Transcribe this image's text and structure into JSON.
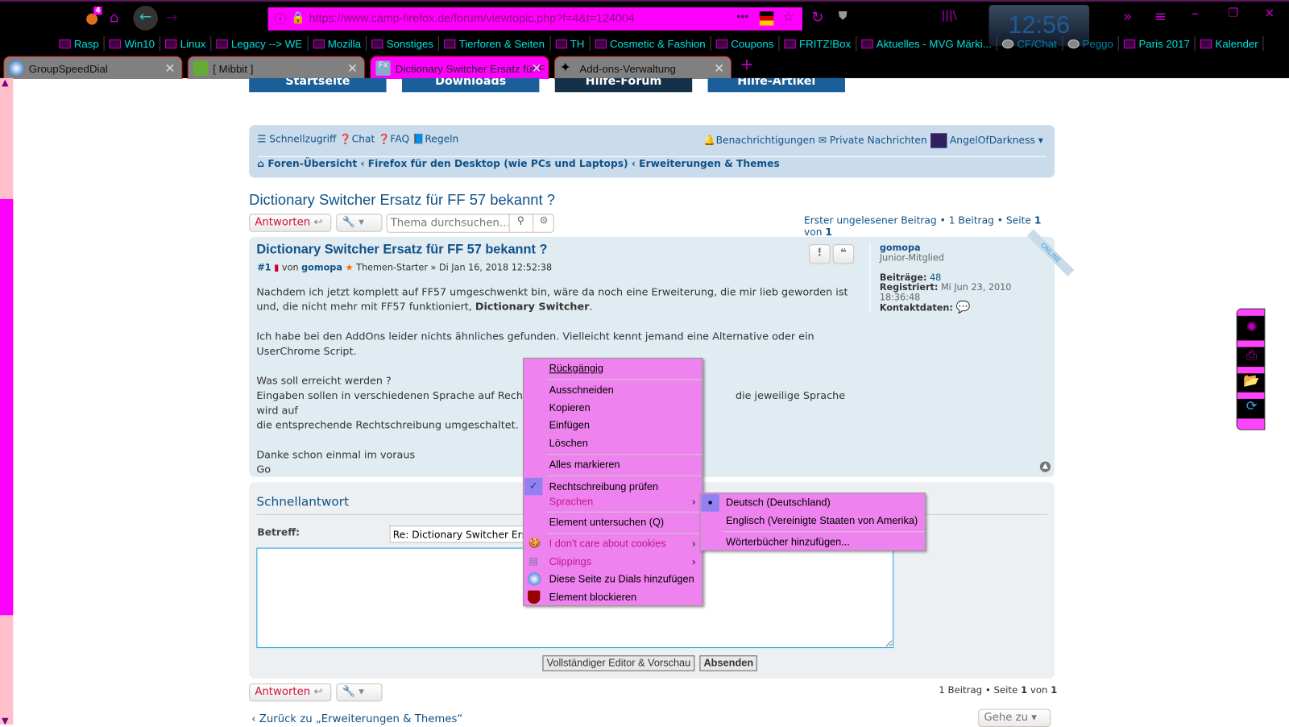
{
  "browser": {
    "badge": "4",
    "url": "https://www.camp-firefox.de/forum/viewtopic.php?f=4&t=124004",
    "clock": "12:56",
    "bookmarks": [
      "Rasp",
      "Win10",
      "Linux",
      "Legacy --> WE",
      "Mozilla",
      "Sonstiges",
      "Tierforen & Seiten",
      "TH",
      "Cosmetic & Fashion",
      "Coupons",
      "FRITZ!Box",
      "Aktuelles - MVG Märki...",
      "CF/Chat",
      "Peggo",
      "Paris 2017",
      "Kalender"
    ],
    "tabs": [
      {
        "label": "GroupSpeedDial"
      },
      {
        "label": "[ Mibbit ]"
      },
      {
        "label": "Dictionary Switcher Ersatz für F"
      },
      {
        "label": "Add-ons-Verwaltung"
      }
    ],
    "colors": {
      "accent": "#ff00ff",
      "chrome_bg": "#000000",
      "bookmark_text": "#00e0e0",
      "menu_bg": "#ee82ee"
    }
  },
  "site_nav": [
    "Startseite",
    "Downloads",
    "Hilfe-Forum",
    "Hilfe-Artikel"
  ],
  "navbar": {
    "quick": "Schnellzugriff",
    "chat": "Chat",
    "faq": "FAQ",
    "rules": "Regeln",
    "notifications": "Benachrichtigungen",
    "pm": "Private Nachrichten",
    "user": "AngelOfDarkness",
    "crumbs": [
      "Foren-Übersicht",
      "Firefox für den Desktop (wie PCs und Laptops)",
      "Erweiterungen & Themes"
    ]
  },
  "topic": {
    "title": "Dictionary Switcher Ersatz für FF 57 bekannt ?",
    "reply": "Antworten",
    "search_placeholder": "Thema durchsuchen...",
    "first_unread": "Erster ungelesener Beitrag",
    "count": "1 Beitrag",
    "page_label": "Seite",
    "page": "1",
    "of": "von",
    "pages": "1"
  },
  "post": {
    "title": "Dictionary Switcher Ersatz für FF 57 bekannt ?",
    "num": "#1",
    "by": "von",
    "author": "gomopa",
    "starter": "Themen-Starter",
    "date": "» Di Jan 16, 2018 12:52:38",
    "p1a": "Nachdem ich jetzt komplett auf FF57 umgeschwenkt bin, wäre da noch eine Erweiterung, die mir lieb geworden ist und, die nicht mehr mit FF57 funktioniert, ",
    "p1b": "Dictionary Switcher",
    "p1c": ".",
    "p2": "Ich habe bei den AddOns leider nichts ähnliches gefunden. Vielleicht kennt jemand eine Alternative oder ein UserChrome Script.",
    "p3": "Was soll erreicht werden ?",
    "p4a": "Eingaben sollen in verschiedenen Sprache auf Rechtschre",
    "p4b": "die jeweilige Sprache wird auf",
    "p4c": "die entsprechende Rechtschreibung umgeschaltet.",
    "p5": "Danke schon einmal im voraus",
    "p6": "Go",
    "profile": {
      "name": "gomopa",
      "rank": "Junior-Mitglied",
      "posts_label": "Beiträge:",
      "posts": "48",
      "reg_label": "Registriert:",
      "reg": "Mi Jun 23, 2010 18:36:48",
      "contact_label": "Kontaktdaten:",
      "online": "ONLINE"
    }
  },
  "quick": {
    "title": "Schnellantwort",
    "subject_label": "Betreff:",
    "subject": "Re: Dictionary Switcher Ersatz für FF 57 bekannt ?",
    "full_editor": "Vollständiger Editor & Vorschau",
    "send": "Absenden"
  },
  "bottom": {
    "back": "Zurück zu „Erweiterungen & Themes“",
    "goto": "Gehe zu"
  },
  "context_menu": {
    "undo": "Rückgängig",
    "cut": "Ausschneiden",
    "copy": "Kopieren",
    "paste": "Einfügen",
    "delete": "Löschen",
    "select_all": "Alles markieren",
    "spell": "Rechtschreibung prüfen",
    "languages": "Sprachen",
    "inspect": "Element untersuchen (Q)",
    "cookies": "I don't care about cookies",
    "clippings": "Clippings",
    "dials": "Diese Seite zu Dials hinzufügen",
    "block": "Element blockieren",
    "submenu": {
      "de": "Deutsch (Deutschland)",
      "en": "Englisch (Vereinigte Staaten von Amerika)",
      "add": "Wörterbücher hinzufügen..."
    }
  }
}
